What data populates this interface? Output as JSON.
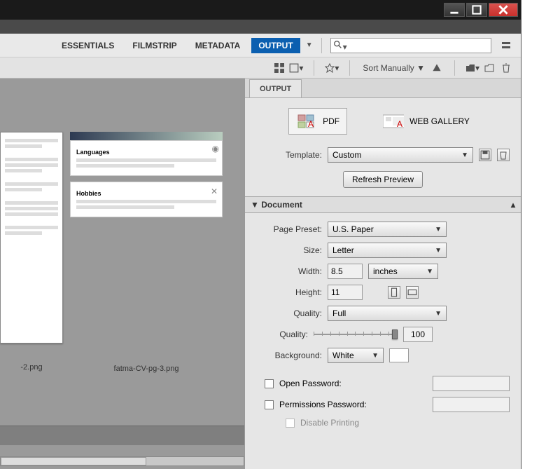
{
  "window": {
    "minimize_icon": "minimize",
    "maximize_icon": "maximize",
    "close_icon": "close"
  },
  "tabs": {
    "essentials": "ESSENTIALS",
    "filmstrip": "FILMSTRIP",
    "metadata": "METADATA",
    "output": "OUTPUT"
  },
  "search": {
    "placeholder": ""
  },
  "toolbar": {
    "sort_label": "Sort Manually"
  },
  "content": {
    "thumb1_label": "-2.png",
    "thumb2_label": "fatma-CV-pg-3.png",
    "card1_title": "Languages",
    "card2_title": "Hobbies"
  },
  "output_panel": {
    "tab_label": "OUTPUT",
    "mode_pdf": "PDF",
    "mode_web": "WEB GALLERY",
    "template_label": "Template:",
    "template_value": "Custom",
    "refresh_btn": "Refresh Preview",
    "doc_section": "Document",
    "page_preset_label": "Page Preset:",
    "page_preset_value": "U.S. Paper",
    "size_label": "Size:",
    "size_value": "Letter",
    "width_label": "Width:",
    "width_value": "8.5",
    "width_unit": "inches",
    "height_label": "Height:",
    "height_value": "11",
    "quality_full_label": "Quality:",
    "quality_full_value": "Full",
    "quality_slider_label": "Quality:",
    "quality_slider_value": "100",
    "background_label": "Background:",
    "background_value": "White",
    "open_pw_label": "Open Password:",
    "perm_pw_label": "Permissions Password:",
    "disable_print_label": "Disable Printing"
  }
}
